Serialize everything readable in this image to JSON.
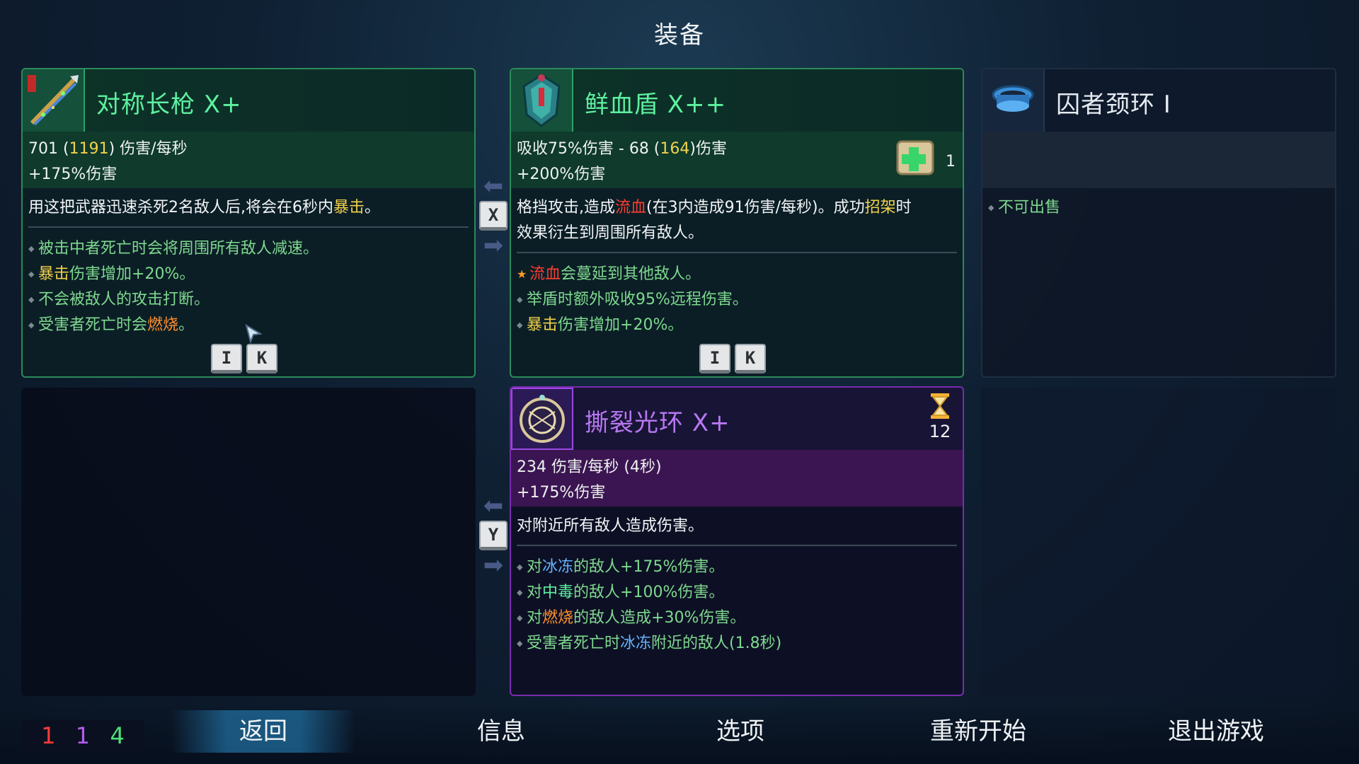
{
  "screen_title": "装备",
  "weapon1": {
    "name": "对称长枪 X+",
    "stat_line1": {
      "a": "701 (",
      "b": "1191",
      "c": ") 伤害/每秒"
    },
    "stat_line2": "+175%伤害",
    "desc": {
      "a": "用这把武器迅速杀死2名敌人后,将会在6秒内",
      "b": "暴击",
      "c": "。"
    },
    "bullets": [
      {
        "text": "被击中者死亡时会将周围所有敌人减速。"
      },
      {
        "hl": "暴击",
        "rest": "伤害增加+20%。"
      },
      {
        "text": "不会被敌人的攻击打断。"
      },
      {
        "pre": "受害者死亡时会",
        "hl": "燃烧",
        "post": "。"
      }
    ],
    "keys": [
      "I",
      "K"
    ]
  },
  "shield": {
    "name": "鲜血盾 X++",
    "stat_line1": {
      "a": "吸收75%伤害 - 68 (",
      "b": "164",
      "c": ")伤害"
    },
    "stat_line2": "+200%伤害",
    "scroll_count": "1",
    "desc": {
      "a": "格挡攻击,造成",
      "b": "流血",
      "c": "(在3内造成91伤害/每秒)。成功",
      "d": "招架",
      "e": "时",
      "f": "效果衍生到周围所有敌人。"
    },
    "bullets": [
      {
        "hl": "流血",
        "rest": "会蔓延到其他敌人。"
      },
      {
        "text": "举盾时额外吸收95%远程伤害。"
      },
      {
        "hl": "暴击",
        "rest": "伤害增加+20%。"
      }
    ],
    "keys": [
      "I",
      "K"
    ]
  },
  "amulet": {
    "name": "囚者颈环 I",
    "bullet": "不可出售"
  },
  "swap1_key": "X",
  "swap2_key": "Y",
  "skill": {
    "name": "撕裂光环 X+",
    "cooldown": "12",
    "stat_line1": "234 伤害/每秒 (4秒)",
    "stat_line2": "+175%伤害",
    "desc": "对附近所有敌人造成伤害。",
    "bullets": [
      {
        "pre": "对",
        "hl": "冰冻",
        "post": "的敌人+175%伤害。"
      },
      {
        "pre": "对",
        "hl": "中毒",
        "post": "的敌人+100%伤害。"
      },
      {
        "pre": "对",
        "hl": "燃烧",
        "post": "的敌人造成+30%伤害。"
      },
      {
        "pre": "受害者死亡时",
        "hl": "冰冻",
        "post": "附近的敌人(1.8秒)"
      }
    ]
  },
  "stats": {
    "brutality": "1",
    "tactics": "1",
    "survival": "4"
  },
  "stat_colors": {
    "brutality": "#ff3b3b",
    "tactics": "#b05cf2",
    "survival": "#4fe07a"
  },
  "menu": {
    "back": "返回",
    "info": "信息",
    "options": "选项",
    "restart": "重新开始",
    "quit": "退出游戏"
  }
}
